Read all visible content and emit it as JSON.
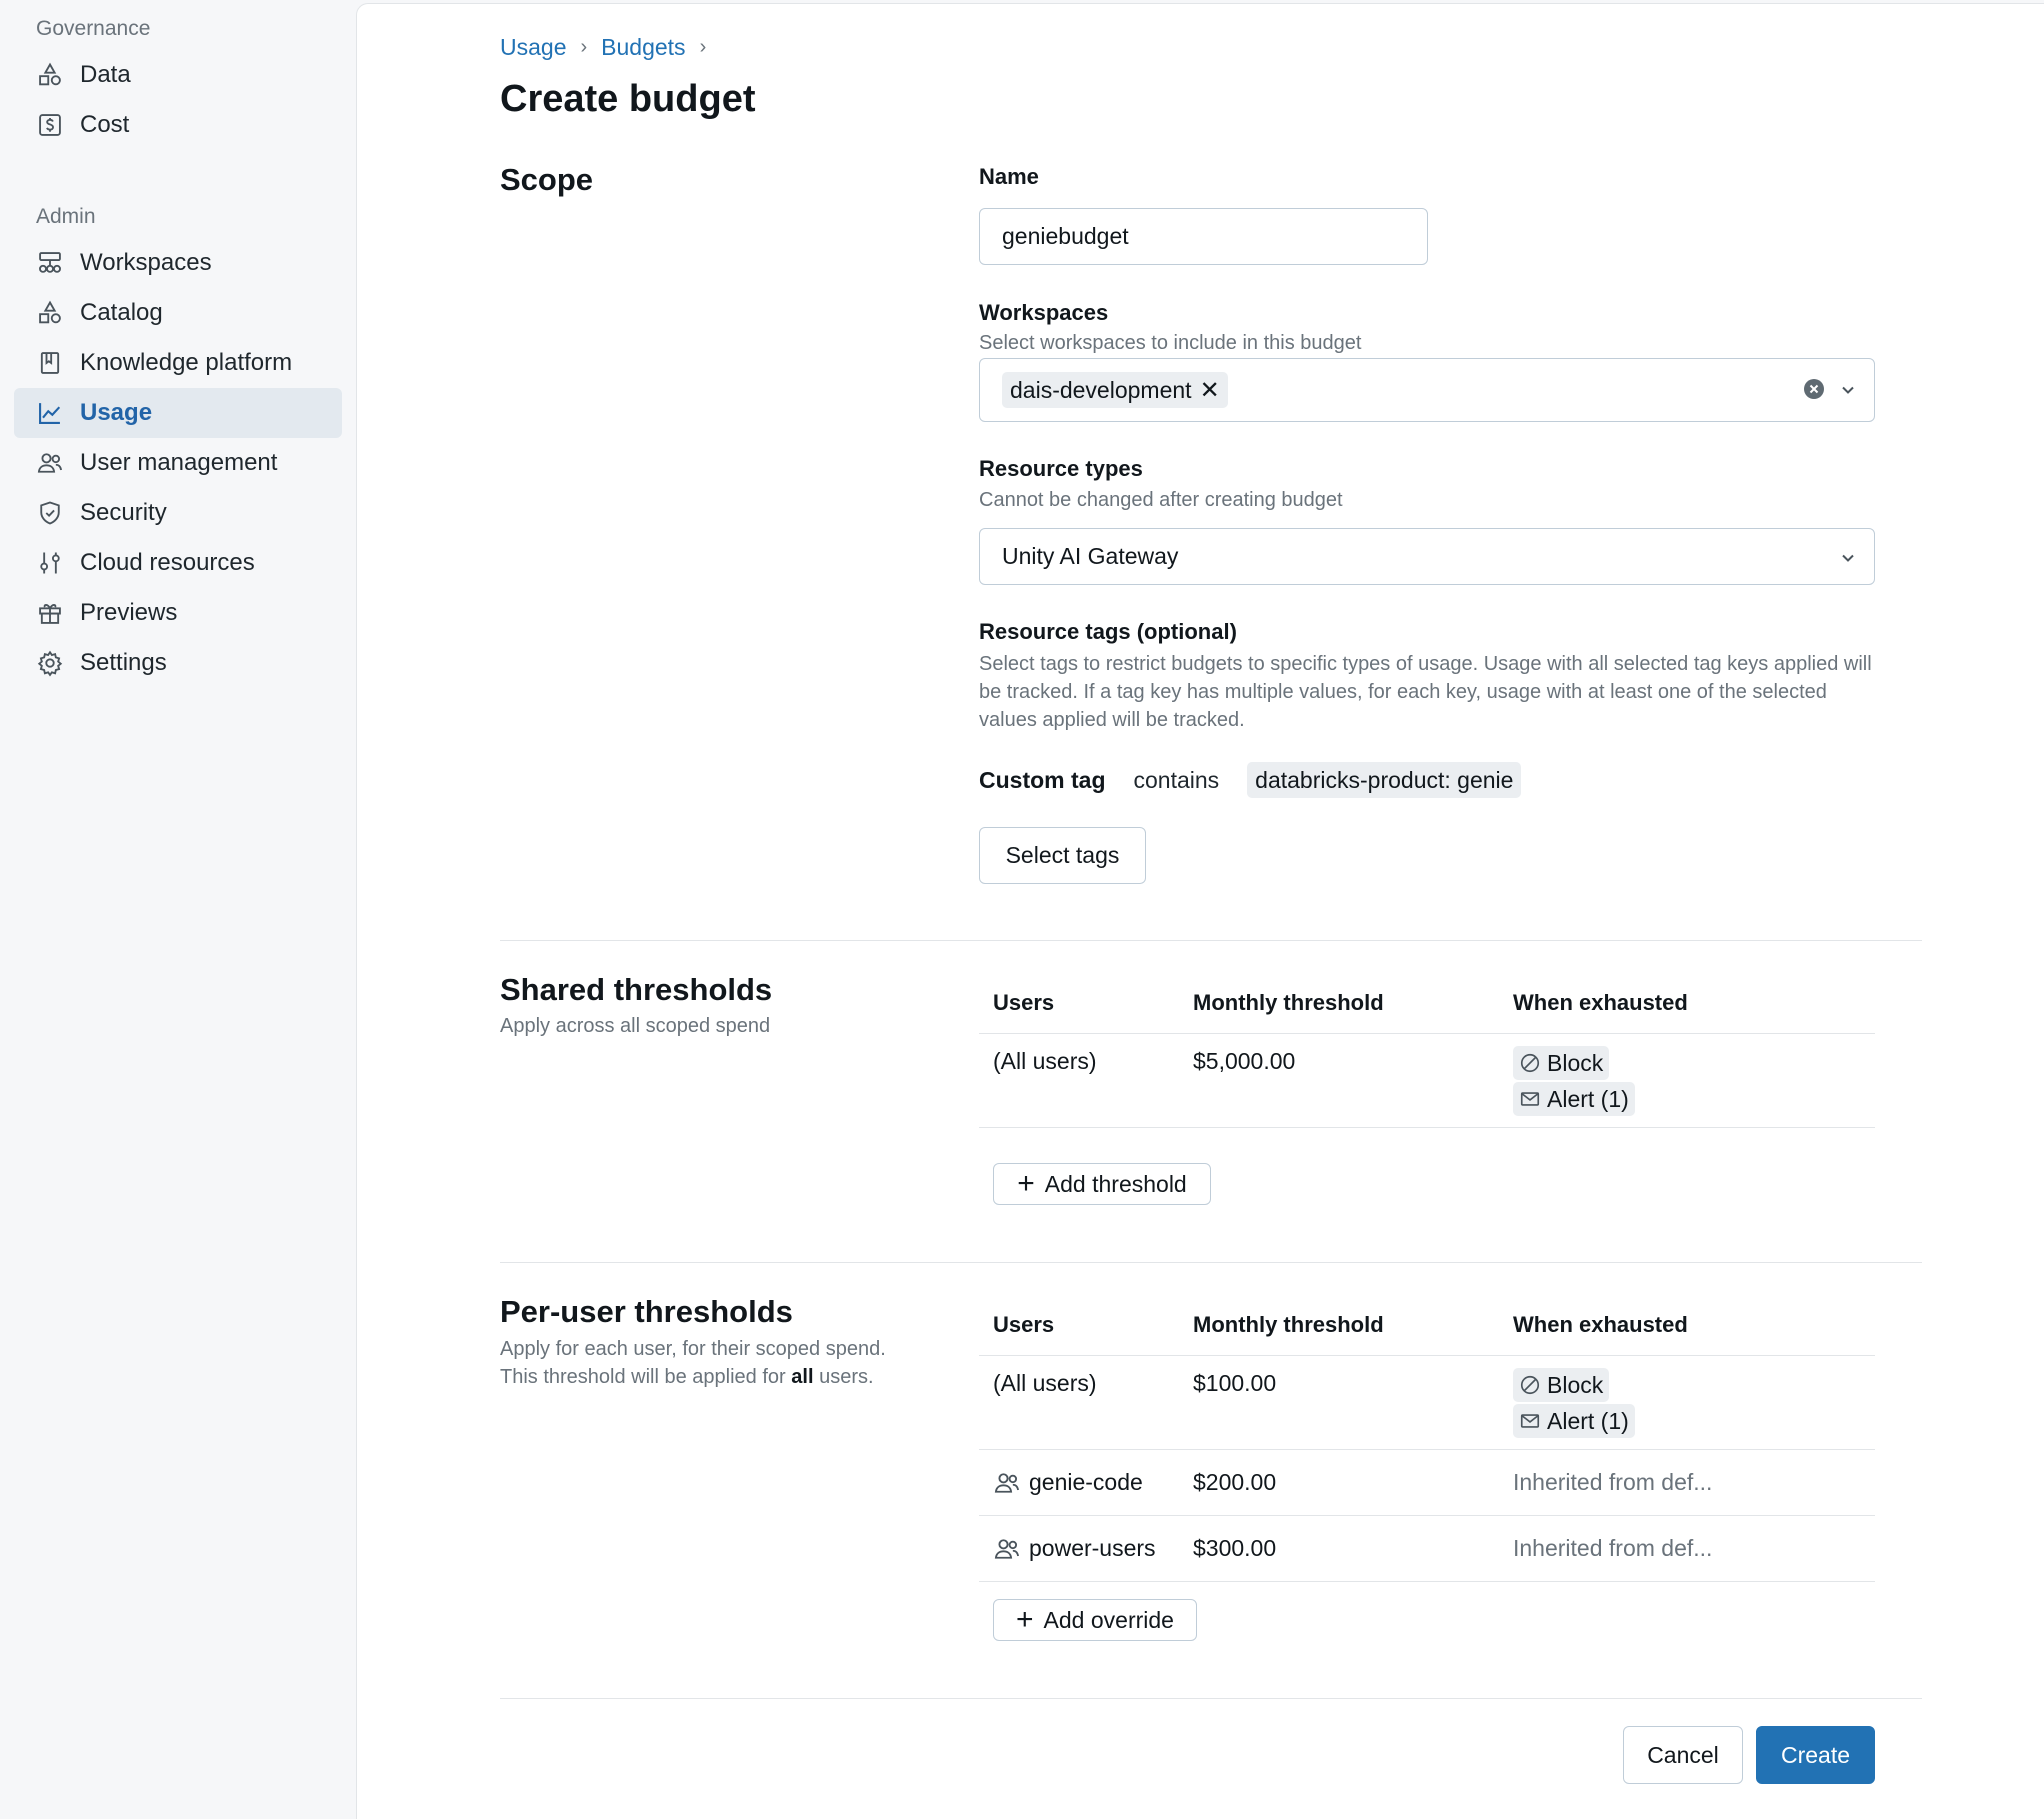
{
  "sidebar": {
    "governance_label": "Governance",
    "governance_items": [
      {
        "label": "Data",
        "icon": "data-shapes-icon"
      },
      {
        "label": "Cost",
        "icon": "dollar-icon"
      }
    ],
    "admin_label": "Admin",
    "admin_items": [
      {
        "label": "Workspaces",
        "icon": "workspaces-icon"
      },
      {
        "label": "Catalog",
        "icon": "catalog-shapes-icon"
      },
      {
        "label": "Knowledge platform",
        "icon": "bookmark-book-icon"
      },
      {
        "label": "Usage",
        "icon": "line-chart-icon",
        "active": true
      },
      {
        "label": "User management",
        "icon": "users-icon"
      },
      {
        "label": "Security",
        "icon": "shield-icon"
      },
      {
        "label": "Cloud resources",
        "icon": "sliders-icon"
      },
      {
        "label": "Previews",
        "icon": "gift-icon"
      },
      {
        "label": "Settings",
        "icon": "gear-icon"
      }
    ]
  },
  "breadcrumb": {
    "items": [
      "Usage",
      "Budgets"
    ],
    "separator": "›"
  },
  "page_title": "Create budget",
  "scope": {
    "title": "Scope",
    "name_label": "Name",
    "name_value": "geniebudget",
    "workspaces_label": "Workspaces",
    "workspaces_hint": "Select workspaces to include in this budget",
    "workspaces_selected": "dais-development",
    "resource_types_label": "Resource types",
    "resource_types_hint": "Cannot be changed after creating budget",
    "resource_types_value": "Unity AI Gateway",
    "resource_tags_label": "Resource tags (optional)",
    "resource_tags_hint": "Select tags to restrict budgets to specific types of usage. Usage with all selected tag keys applied will be tracked. If a tag key has multiple values, for each key, usage with at least one of the selected values applied will be tracked.",
    "tag_key": "Custom tag",
    "tag_operator": "contains",
    "tag_value": "databricks-product: genie",
    "select_tags_button": "Select tags"
  },
  "shared_thresholds": {
    "title": "Shared thresholds",
    "subtitle": "Apply across all scoped spend",
    "columns": [
      "Users",
      "Monthly threshold",
      "When exhausted"
    ],
    "rows": [
      {
        "users": "(All users)",
        "threshold": "$5,000.00",
        "actions": [
          "Block",
          "Alert (1)"
        ]
      }
    ],
    "add_button": "Add threshold"
  },
  "per_user_thresholds": {
    "title": "Per-user thresholds",
    "subtitle_line1": "Apply for each user, for their scoped spend.",
    "subtitle_pre": "This threshold will be applied for",
    "subtitle_bold": "all",
    "subtitle_post": "users.",
    "columns": [
      "Users",
      "Monthly threshold",
      "When exhausted"
    ],
    "default_row": {
      "users": "(All users)",
      "threshold": "$100.00",
      "actions": [
        "Block",
        "Alert (1)"
      ]
    },
    "override_rows": [
      {
        "users": "genie-code",
        "threshold": "$200.00",
        "when_exhausted": "Inherited from def..."
      },
      {
        "users": "power-users",
        "threshold": "$300.00",
        "when_exhausted": "Inherited from def..."
      }
    ],
    "add_button": "Add override"
  },
  "footer": {
    "cancel": "Cancel",
    "create": "Create"
  },
  "colors": {
    "accent": "#2272b4",
    "active_nav_bg": "#e3e9ef",
    "muted_text": "#6a737b"
  }
}
